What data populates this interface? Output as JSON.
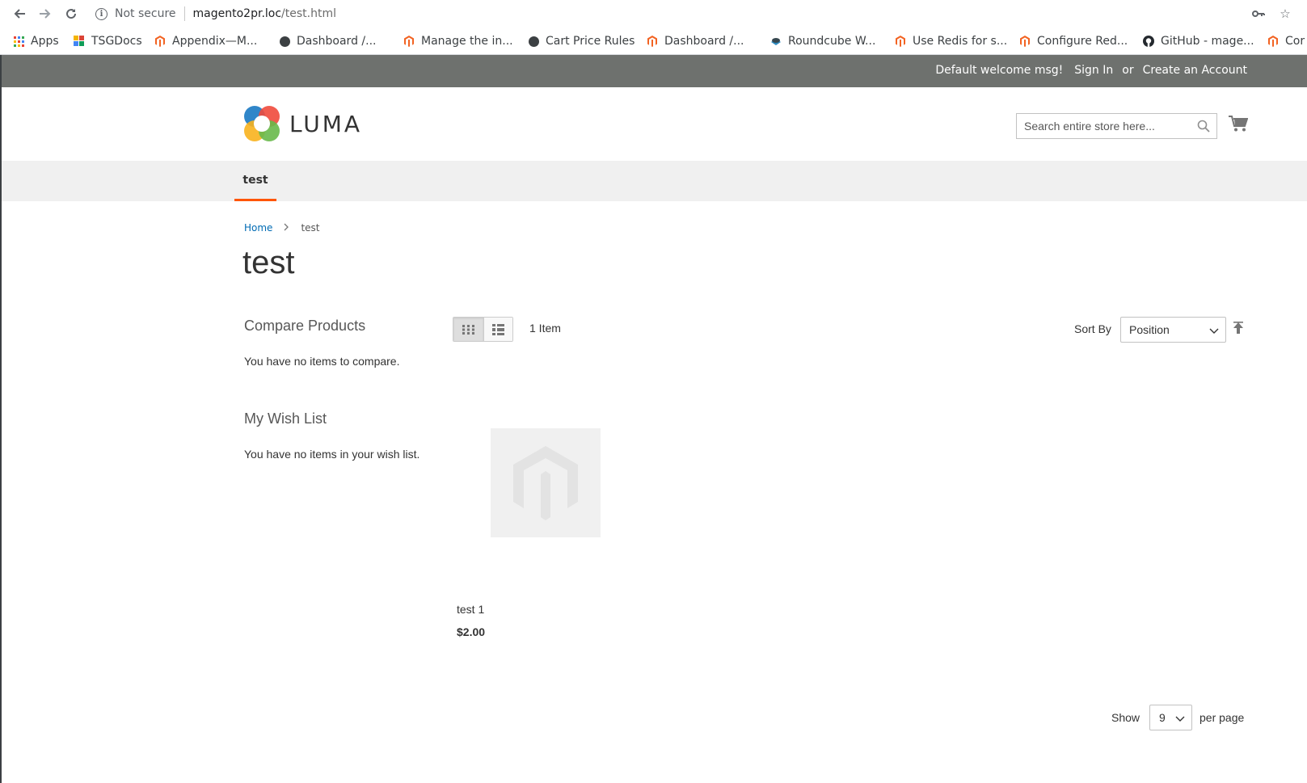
{
  "browser": {
    "security_label": "Not secure",
    "url_host": "magento2pr.loc",
    "url_path": "/test.html",
    "bookmarks": [
      {
        "label": "Apps",
        "icon": "apps-grid-icon"
      },
      {
        "label": "TSGDocs",
        "icon": "tsgdocs-icon"
      },
      {
        "label": "Appendix—M...",
        "icon": "magento-icon"
      },
      {
        "label": "Dashboard /...",
        "icon": "globe-icon"
      },
      {
        "label": "Manage the in...",
        "icon": "magento-icon"
      },
      {
        "label": "Cart Price Rules",
        "icon": "globe-icon"
      },
      {
        "label": "Dashboard /...",
        "icon": "magento-icon"
      },
      {
        "label": "Roundcube W...",
        "icon": "roundcube-icon"
      },
      {
        "label": "Use Redis for s...",
        "icon": "magento-icon"
      },
      {
        "label": "Configure Red...",
        "icon": "magento-icon"
      },
      {
        "label": "GitHub - mage...",
        "icon": "github-icon"
      },
      {
        "label": "Cor",
        "icon": "magento-icon"
      }
    ]
  },
  "header": {
    "welcome": "Default welcome msg!",
    "sign_in": "Sign In",
    "or": "or",
    "create_account": "Create an Account"
  },
  "logo": {
    "text": "LUMA"
  },
  "search": {
    "placeholder": "Search entire store here..."
  },
  "nav": {
    "items": [
      {
        "label": "test"
      }
    ]
  },
  "breadcrumb": {
    "home": "Home",
    "current": "test"
  },
  "page": {
    "title": "test"
  },
  "sidebar": {
    "compare_title": "Compare Products",
    "compare_empty": "You have no items to compare.",
    "wishlist_title": "My Wish List",
    "wishlist_empty": "You have no items in your wish list."
  },
  "toolbar": {
    "amount": "1 Item",
    "sort_label": "Sort By",
    "sort_value": "Position",
    "show_label": "Show",
    "limit_value": "9",
    "per_page": "per page"
  },
  "products": [
    {
      "name": "test 1",
      "price": "$2.00"
    }
  ],
  "colors": {
    "header_bg": "#6e716e",
    "nav_active": "#ff5501",
    "link": "#006bb4",
    "magento_orange": "#f26322"
  }
}
